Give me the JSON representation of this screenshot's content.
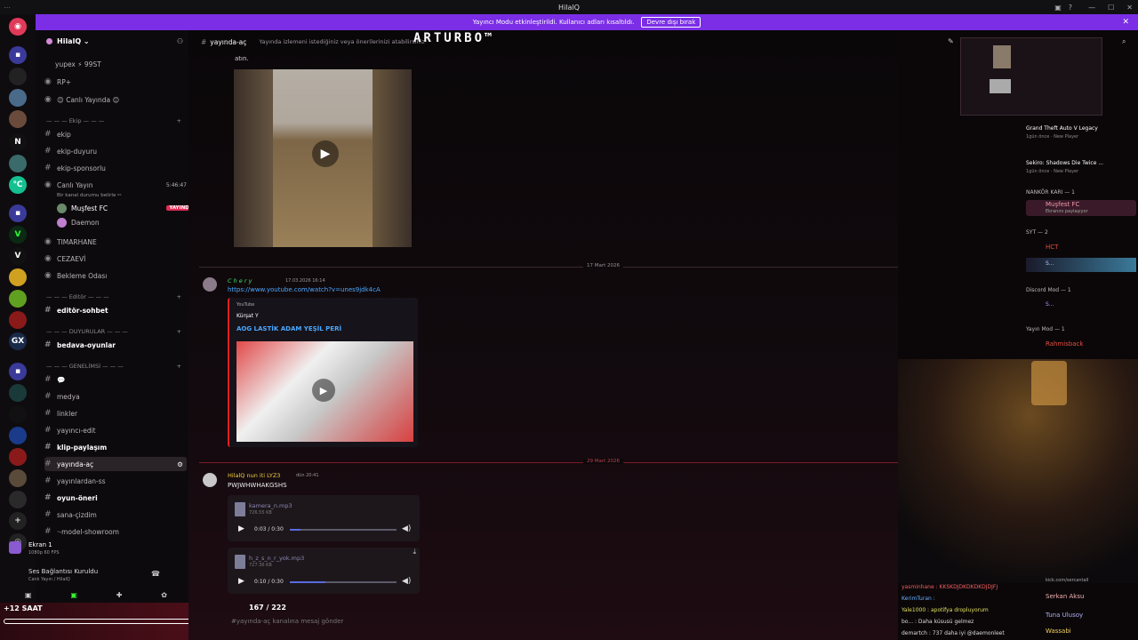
{
  "window": {
    "title": "HilalQ"
  },
  "banner": {
    "text": "Yayıncı Modu etkinleştirildi. Kullanıcı adları kısaltıldı.",
    "button": "Devre dışı bırak"
  },
  "overlay": {
    "logo": "ARTURBO™",
    "counter": "167 / 222",
    "timer": "+12 SAAT"
  },
  "server": {
    "name": "HilalQ"
  },
  "channels": {
    "top_user": "yupex ⚡ 99ST",
    "items": [
      {
        "label": "RP+"
      },
      {
        "label": "😊 Canlı Yayında 😊"
      },
      {
        "label": "ekip"
      },
      {
        "label": "ekip-duyuru"
      },
      {
        "label": "ekip-sponsorlu"
      },
      {
        "label": "Canlı Yayın"
      },
      {
        "label": "TIMARHANE"
      },
      {
        "label": "CEZAEVİ"
      },
      {
        "label": "Bekleme Odası"
      },
      {
        "label": "editör-sohbet"
      },
      {
        "label": "bedava-oyunlar"
      },
      {
        "label": "💬"
      },
      {
        "label": "medya"
      },
      {
        "label": "linkler"
      },
      {
        "label": "yayıncı-edit"
      },
      {
        "label": "klip-paylaşım"
      },
      {
        "label": "yayında-aç"
      },
      {
        "label": "yayınlardan-ss"
      },
      {
        "label": "oyun-öneri"
      },
      {
        "label": "sana-çizdim"
      },
      {
        "label": "·-model-showroom"
      }
    ],
    "categories": [
      "— — — Ekip — — —",
      "— — — Editör — — —",
      "— — — DUYURULAR — — —",
      "— — — GENELİMSİ — — —"
    ],
    "live_channel_status": "Bir kanal durumu belirle ✏",
    "live_time": "5:46:47",
    "live_users": [
      "Muşfest FC",
      "Daemon"
    ],
    "live_badge": "YAYINDA"
  },
  "voice": {
    "screen_label": "Ekran 1",
    "screen_sub": "1080p 60 FPS",
    "status": "Ses Bağlantısı Kuruldu",
    "status_sub": "Canlı Yayın / HilalQ"
  },
  "header": {
    "channel": "yayında-aç",
    "topic": "Yayında izlemeni istediğiniz veya önerilerinizi atabilirsiniz"
  },
  "messages": {
    "top_text": "atın.",
    "date1": "17 Mart 2026",
    "m1_name": "C h e r y",
    "m1_time": "17.03.2026 16:14",
    "m1_link": "https://www.youtube.com/watch?v=unes9jdk4cA",
    "embed_provider": "YouTube",
    "embed_author": "Kürşat Y",
    "embed_title": "AOG LASTİK ADAM YEŞİL PERİ",
    "date2": "29 Mart 2026",
    "m2_name": "HilalQ nun iti LYZ3",
    "m2_time": "dün 20:41",
    "m2_text": "PWJWHWHAKGSHS",
    "files": [
      {
        "name": "kamera_n.mp3",
        "size": "726.55 KB",
        "time": "0:03 / 0:30",
        "progress": 0.1
      },
      {
        "name": "h_z_s_n_r_yok.mp3",
        "size": "727.36 KB",
        "time": "0:10 / 0:30",
        "progress": 0.33
      }
    ],
    "composer_placeholder": "#yayında-aç kanalına mesaj gönder"
  },
  "activity": {
    "items": [
      {
        "game": "Grand Theft Auto V Legacy",
        "sub": "1gün önce · New Player"
      },
      {
        "game": "Sekiro: Shadows Die Twice ...",
        "sub": "1gün önce · New Player"
      }
    ],
    "groups": [
      "NANKÖR KARI — 1",
      "SYT — 2",
      "Discord Mod — 1",
      "Yayın Mod — 1"
    ],
    "members": [
      "Muşfest FC",
      "Ekranını paylaşıyor",
      "HCT",
      "S...",
      "S...",
      "Rahmisback"
    ]
  },
  "chat": {
    "lines": [
      "yasminhane : KKSKDJDKDKDKDJDJFJ",
      "KerimTuran :",
      "Yale1000 : apotifya dropluyorum",
      "bo... : Daha küsusü gelmez",
      "demartch : 737 daha iyi @daemonleet"
    ],
    "names": [
      "Serkan Aksu",
      "Tuna Ulusoy",
      "Wassabi"
    ],
    "kick": "kick.com/sercantall"
  }
}
